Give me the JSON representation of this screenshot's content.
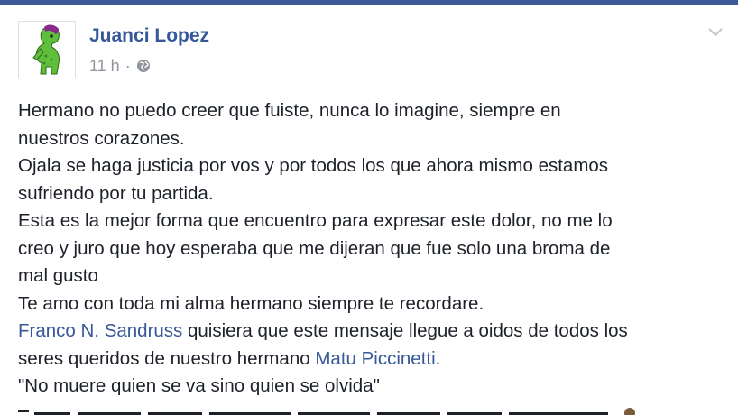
{
  "post": {
    "author": "Juanci Lopez",
    "time": "11 h",
    "separator": "·",
    "privacy_icon": "globe-icon",
    "options_icon": "chevron-down-icon",
    "avatar_icon": "cartoon-avatar-icon",
    "lines": {
      "l1": "Hermano no puedo creer que fuiste, nunca lo imagine, siempre en",
      "l2": "nuestros corazones.",
      "l3": "Ojala se haga justicia por vos y por todos los que ahora mismo estamos",
      "l4": "sufriendo por tu partida.",
      "l5": "Esta es la mejor forma que encuentro para expresar este dolor, no me lo",
      "l6": "creo y juro que hoy esperaba que me dijeran que fue solo una broma de",
      "l7": "mal gusto",
      "l8": "Te amo con toda mi alma hermano siempre te recordare.",
      "mention1": "Franco N. Sandruss",
      "l9_rest": " quisiera que este mensaje llegue a oidos de todos los",
      "l10_start": "seres queridos de nuestro hermano ",
      "mention2": "Matu Piccinetti",
      "l10_end": ".",
      "l11": "\"No muere quien se va sino quien se olvida\""
    }
  }
}
